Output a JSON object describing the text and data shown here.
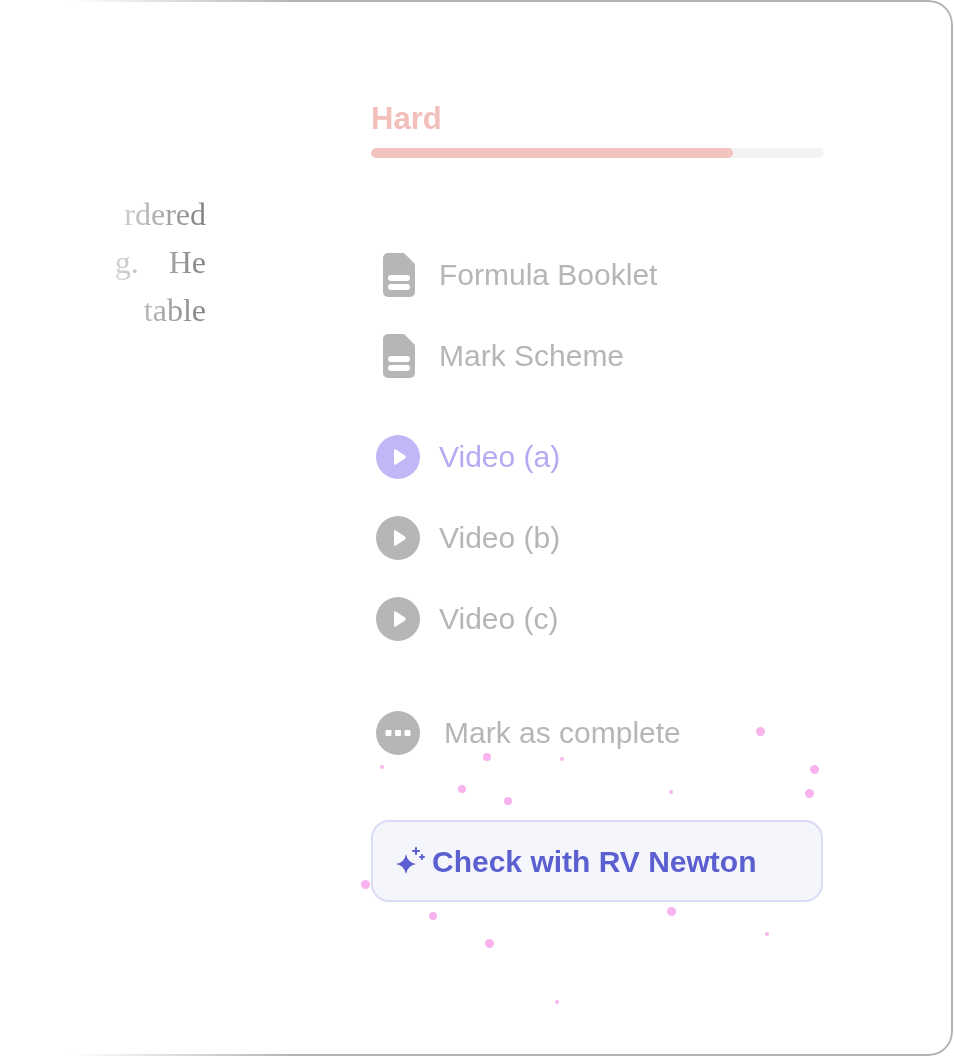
{
  "excerpt": {
    "lines": [
      "rdered",
      "g. He",
      "table"
    ]
  },
  "difficulty": {
    "label": "Hard",
    "level": 0.8
  },
  "documents": [
    {
      "label": "Formula Booklet"
    },
    {
      "label": "Mark Scheme"
    }
  ],
  "videos": [
    {
      "label": "Video (a)",
      "selected": true
    },
    {
      "label": "Video (b)",
      "selected": false
    },
    {
      "label": "Video (c)",
      "selected": false
    }
  ],
  "mark_complete": {
    "label": "Mark as complete"
  },
  "check_button": {
    "label": "Check with RV Newton"
  }
}
